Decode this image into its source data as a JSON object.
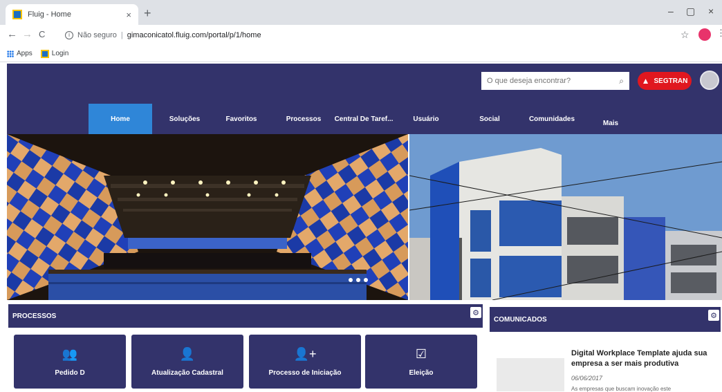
{
  "browser": {
    "tab_title": "Fluig - Home",
    "tab_close": "×",
    "new_tab": "+",
    "minimize": "–",
    "restore": "▢",
    "close": "×",
    "back": "←",
    "forward": "→",
    "reload": "C",
    "security_label": "Não seguro",
    "separator": "|",
    "url": "gimaconicatol.fluig.com/portal/p/1/home",
    "bookmarks": [
      {
        "label": "Apps"
      },
      {
        "label": "Login"
      }
    ]
  },
  "header": {
    "search_placeholder": "O que deseja encontrar?",
    "sos_label": "SEGTRAN"
  },
  "nav": {
    "items": [
      {
        "label": "Home",
        "active": true
      },
      {
        "label": "Soluções"
      },
      {
        "label": "Favoritos"
      },
      {
        "label": "Processos"
      },
      {
        "label": "Central De Taref..."
      },
      {
        "label": "Usuário"
      },
      {
        "label": "Social"
      },
      {
        "label": "Comunidades"
      },
      {
        "label": "Mais"
      }
    ]
  },
  "banner": {
    "slides_dots": 3
  },
  "processos": {
    "title": "PROCESSOS",
    "cards": [
      {
        "label": "Pedido D",
        "icon": "users-icon"
      },
      {
        "label": "Atualização Cadastral",
        "icon": "user-edit-icon"
      },
      {
        "label": "Processo de Iniciação",
        "icon": "user-plus-icon"
      },
      {
        "label": "Eleição",
        "icon": "vote-box-icon"
      }
    ]
  },
  "comunicados": {
    "title": "COMUNICADOS",
    "news": {
      "title": "Digital Workplace Template ajuda sua empresa a ser mais produtiva",
      "date": "06/06/2017",
      "excerpt": "As empresas que buscam inovação este"
    }
  },
  "colors": {
    "primary": "#33336b",
    "active_nav": "#2f86d8",
    "alert": "#e0171f"
  }
}
